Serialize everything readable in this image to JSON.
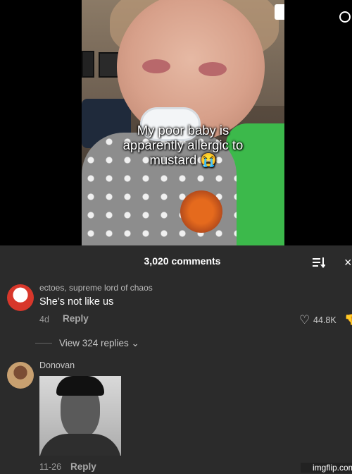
{
  "video": {
    "caption_lines": [
      "My poor baby is",
      "apparently allergic to",
      "mustard 😭"
    ]
  },
  "comments_panel": {
    "title": "3,020 comments",
    "close_glyph": "×",
    "comments": [
      {
        "username": "ectoes, supreme lord of chaos",
        "text": "She’s not like us",
        "time": "4d",
        "reply_label": "Reply",
        "likes": "44.8K",
        "view_replies": "View 324 replies ⌄"
      },
      {
        "username": "Donovan",
        "time": "11-26",
        "reply_label": "Reply"
      }
    ]
  },
  "watermark": "imgflip.com",
  "colors": {
    "panel_bg": "#2b2b2b",
    "video_bg": "#000000",
    "secondary_text": "#9a9a9a"
  }
}
